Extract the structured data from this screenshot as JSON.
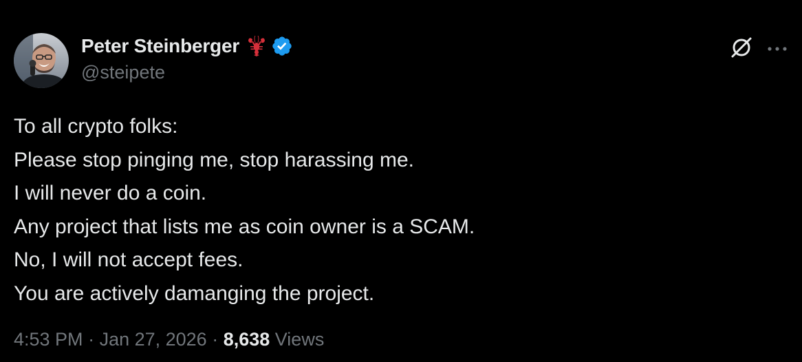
{
  "author": {
    "display_name": "Peter Steinberger",
    "handle": "@steipete",
    "emoji_icon": "lobster-icon",
    "verified_icon": "verified-badge-icon",
    "verified_color": "#1d9bf0"
  },
  "actions": {
    "grok_icon": "grok-icon",
    "more_icon": "more-icon"
  },
  "tweet": {
    "lines": [
      "To all crypto folks:",
      "Please stop pinging me, stop harassing me.",
      "I will never do a coin.",
      "Any project that lists me as coin owner is a SCAM.",
      "No, I will not accept fees.",
      "You are actively damanging the project."
    ]
  },
  "meta": {
    "time": "4:53 PM",
    "separator": " · ",
    "date": "Jan 27, 2026",
    "views_count": "8,638",
    "views_label": " Views"
  },
  "colors": {
    "background": "#000000",
    "primary_text": "#e7e9ea",
    "secondary_text": "#71767b",
    "accent": "#1d9bf0"
  }
}
